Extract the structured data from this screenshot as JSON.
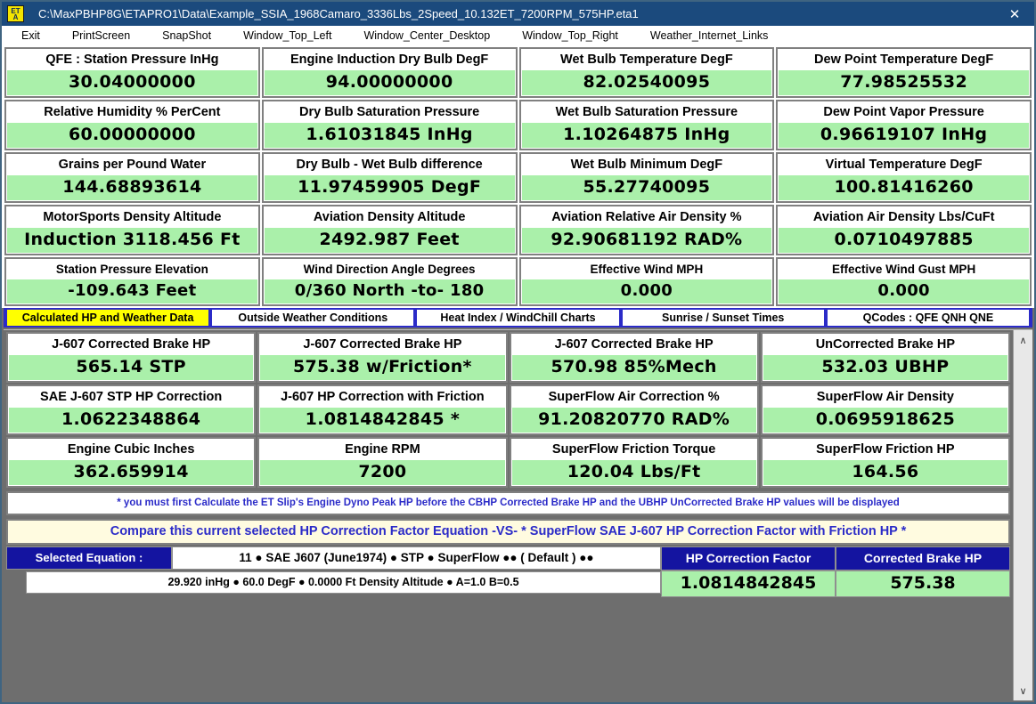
{
  "window": {
    "icon_line1": "ET",
    "icon_line2": "A",
    "title": "C:\\MaxPBHP8G\\ETAPRO1\\Data\\Example_SSIA_1968Camaro_3336Lbs_2Speed_10.132ET_7200RPM_575HP.eta1",
    "close_glyph": "✕"
  },
  "menu": {
    "items": [
      {
        "label": "Exit"
      },
      {
        "label": "PrintScreen"
      },
      {
        "label": "SnapShot"
      },
      {
        "label": "Window_Top_Left"
      },
      {
        "label": "Window_Center_Desktop"
      },
      {
        "label": "Window_Top_Right"
      },
      {
        "label": "Weather_Internet_Links"
      }
    ]
  },
  "weather": {
    "rows": [
      [
        {
          "label": "QFE :  Station Pressure InHg",
          "value": "30.04000000"
        },
        {
          "label": "Engine Induction Dry Bulb DegF",
          "value": "94.00000000"
        },
        {
          "label": "Wet Bulb Temperature DegF",
          "value": "82.02540095"
        },
        {
          "label": "Dew Point Temperature DegF",
          "value": "77.98525532"
        }
      ],
      [
        {
          "label": "Relative Humidity % PerCent",
          "value": "60.00000000"
        },
        {
          "label": "Dry Bulb Saturation Pressure",
          "value": "1.61031845  InHg"
        },
        {
          "label": "Wet Bulb Saturation Pressure",
          "value": "1.10264875  InHg"
        },
        {
          "label": "Dew Point Vapor Pressure",
          "value": "0.96619107  InHg"
        }
      ],
      [
        {
          "label": "Grains per Pound Water",
          "value": "144.68893614"
        },
        {
          "label": "Dry Bulb - Wet Bulb   difference",
          "value": "11.97459905  DegF"
        },
        {
          "label": "Wet Bulb  Minimum  DegF",
          "value": "55.27740095"
        },
        {
          "label": "Virtual Temperature DegF",
          "value": "100.81416260"
        }
      ],
      [
        {
          "label": "MotorSports Density Altitude",
          "value": "Induction  3118.456 Ft"
        },
        {
          "label": "Aviation Density Altitude",
          "value": "2492.987  Feet"
        },
        {
          "label": "Aviation Relative Air Density %",
          "value": "92.90681192  RAD%"
        },
        {
          "label": "Aviation Air Density Lbs/CuFt",
          "value": "0.0710497885"
        }
      ],
      [
        {
          "label": "Station Pressure Elevation",
          "value": "-109.643 Feet"
        },
        {
          "label": "Wind Direction Angle Degrees",
          "value": "0/360 North -to- 180"
        },
        {
          "label": "Effective Wind MPH",
          "value": "0.000"
        },
        {
          "label": "Effective Wind Gust MPH",
          "value": "0.000"
        }
      ]
    ]
  },
  "tabs": [
    {
      "label": "Calculated HP and Weather Data",
      "active": true
    },
    {
      "label": "Outside Weather Conditions",
      "active": false
    },
    {
      "label": "Heat Index / WindChill  Charts",
      "active": false
    },
    {
      "label": "Sunrise / Sunset  Times",
      "active": false
    },
    {
      "label": "QCodes :  QFE  QNH  QNE",
      "active": false
    }
  ],
  "hp": {
    "rows": [
      [
        {
          "label": "J-607 Corrected Brake HP",
          "value": "565.14     STP"
        },
        {
          "label": "J-607 Corrected Brake HP",
          "value": "575.38    w/Friction*"
        },
        {
          "label": "J-607 Corrected Brake HP",
          "value": "570.98    85%Mech"
        },
        {
          "label": "UnCorrected Brake HP",
          "value": "532.03    UBHP"
        }
      ],
      [
        {
          "label": "SAE J-607  STP  HP  Correction",
          "value": "1.0622348864"
        },
        {
          "label": "J-607 HP Correction with Friction",
          "value": "1.0814842845   *"
        },
        {
          "label": "SuperFlow Air Correction %",
          "value": "91.20820770  RAD%"
        },
        {
          "label": "SuperFlow Air Density",
          "value": "0.0695918625"
        }
      ],
      [
        {
          "label": "Engine Cubic Inches",
          "value": "362.659914"
        },
        {
          "label": "Engine RPM",
          "value": "7200"
        },
        {
          "label": "SuperFlow Friction Torque",
          "value": "120.04  Lbs/Ft"
        },
        {
          "label": "SuperFlow Friction HP",
          "value": "164.56"
        }
      ]
    ],
    "note": "* you must first Calculate the ET Slip's Engine Dyno Peak HP before the CBHP Corrected Brake HP  and  the UBHP UnCorrected Brake HP values will be displayed",
    "compare": "Compare this current selected HP Correction Factor Equation    -VS-    * SuperFlow SAE J-607 HP Correction Factor with Friction HP *"
  },
  "equation": {
    "name_label": "Selected  Equation  :",
    "selected": "11 ●  SAE J607 (June1974) ● STP ●  SuperFlow ●● ( Default ) ●●",
    "conditions": "29.920 inHg ● 60.0 DegF ● 0.0000 Ft Density Altitude ● A=1.0 B=0.5",
    "factor_header": "HP Correction Factor",
    "factor_value": "1.0814842845",
    "brake_header": "Corrected Brake HP",
    "brake_value": "575.38"
  },
  "scrollbar": {
    "up_glyph": "∧",
    "down_glyph": "∨"
  },
  "colors": {
    "titlebar": "#1b4a7d",
    "value_green": "#aaf0aa",
    "tab_active": "#ffff00",
    "tab_strip_border": "#2b2bc8",
    "note_text": "#2b2bc8",
    "header_blue": "#1414a0",
    "panel_gray": "#6e6e6e"
  }
}
